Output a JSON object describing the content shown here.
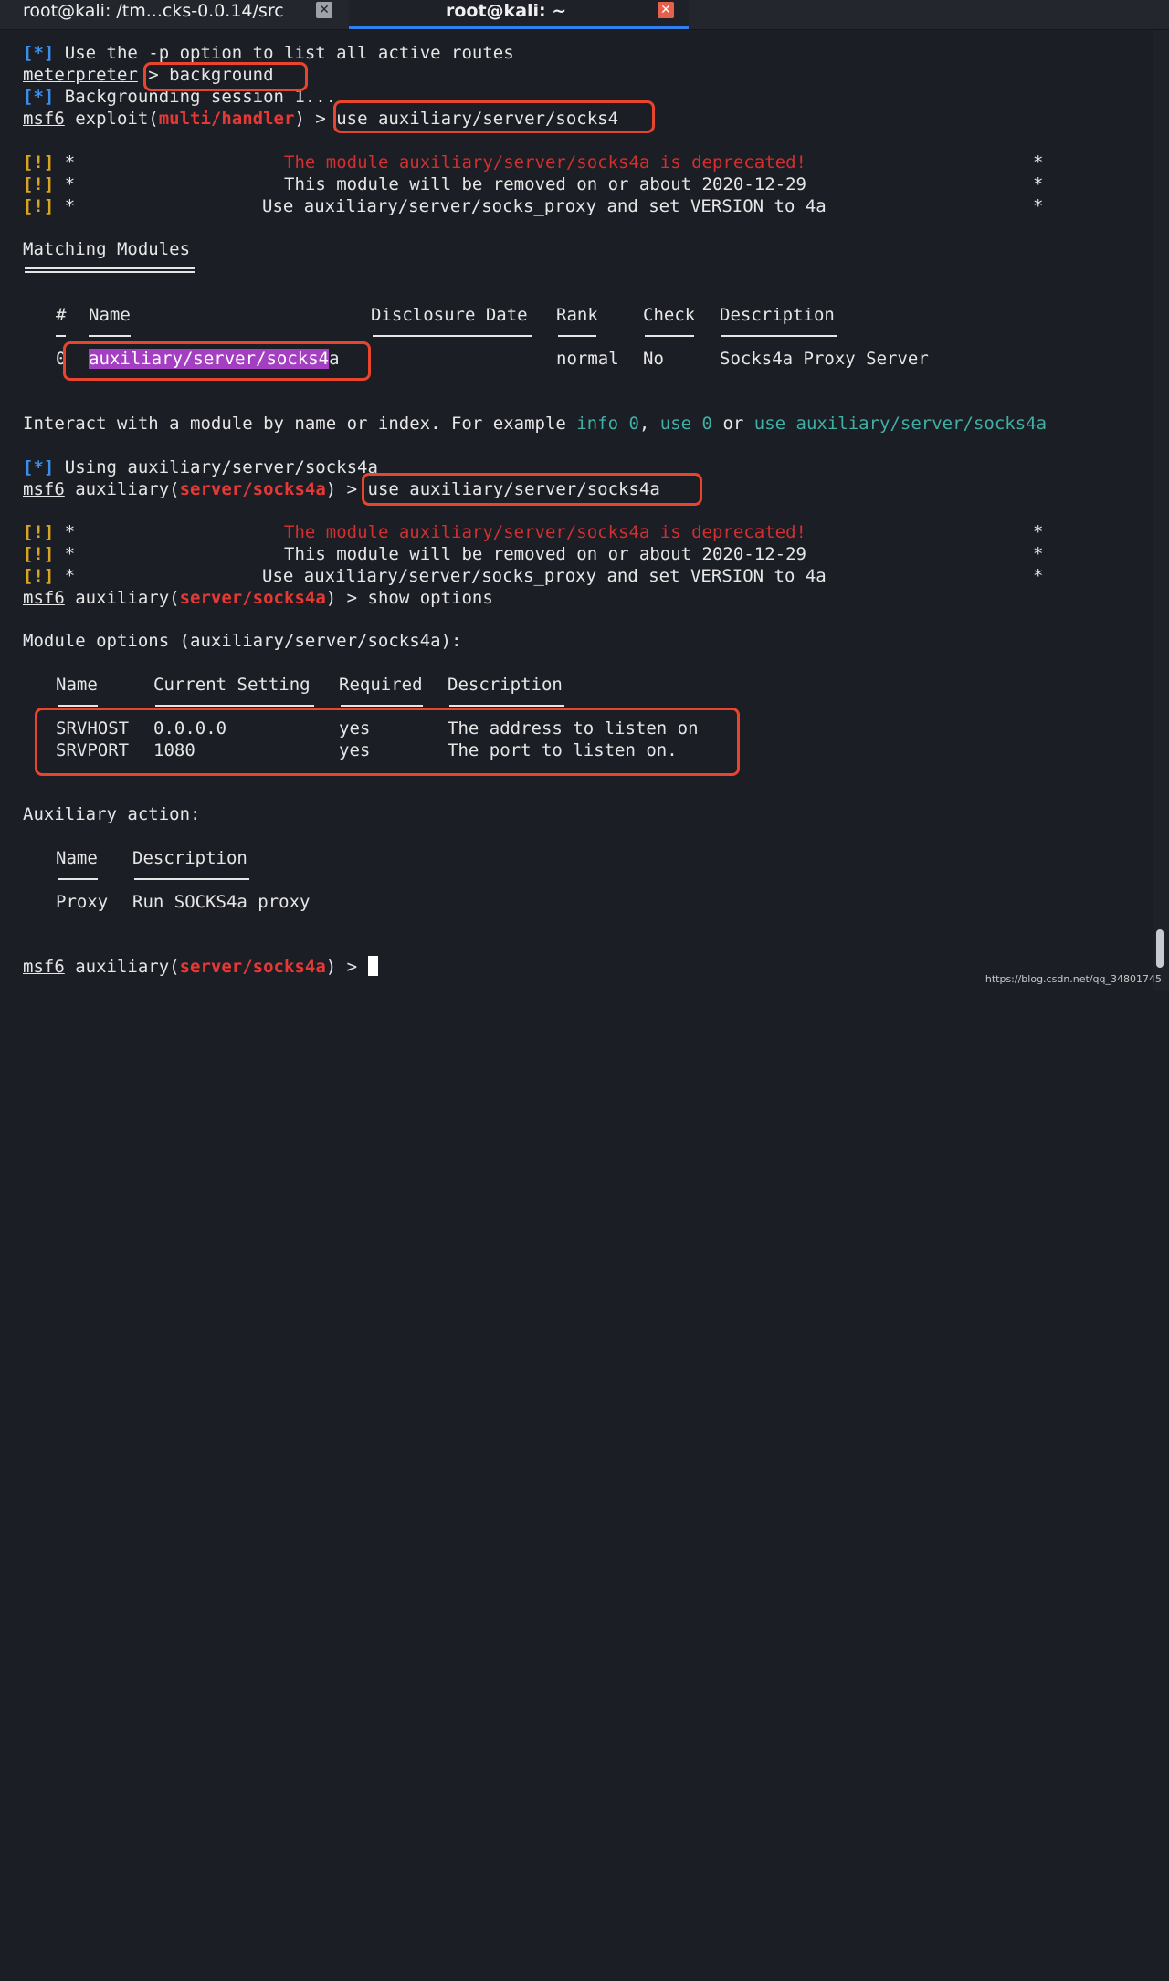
{
  "tabs": [
    {
      "title": "root@kali: /tm...cks-0.0.14/src",
      "close": "✕"
    },
    {
      "title": "root@kali: ~",
      "close": "✕"
    }
  ],
  "lines": {
    "l1_tag": "[*]",
    "l1_text": " Use the -p option to list all active routes",
    "l2_prompt": "meterpreter",
    "l2_cmd": " > background",
    "l3_tag": "[*]",
    "l3_text": " Backgrounding session 1...",
    "l4_msf": "msf6",
    "l4_a": " exploit(",
    "l4_mod": "multi/handler",
    "l4_b": ") > use auxiliary/server/socks4",
    "warn_tag": "[!]",
    "warn_star": " *",
    "w1": "The module auxiliary/server/socks4a is deprecated!",
    "w2": "This module will be removed on or about 2020-12-29",
    "w3": "Use auxiliary/server/socks_proxy and set VERSION to 4a",
    "star": "*",
    "matching": "Matching Modules",
    "col_hash": "#",
    "col_name": "Name",
    "col_date": "Disclosure Date",
    "col_rank": "Rank",
    "col_check": "Check",
    "col_desc": "Description",
    "row_idx": "0",
    "row_name_hl": "auxiliary/server/socks4",
    "row_name_tail": "a",
    "row_rank": "normal",
    "row_check": "No",
    "row_desc": "Socks4a Proxy Server",
    "interact_a": "Interact with a module by name or index. For example ",
    "interact_info": "info 0",
    "interact_b": ", ",
    "interact_use0": "use 0",
    "interact_c": " or ",
    "interact_use": "use auxiliary/server/socks4a",
    "using_tag": "[*]",
    "using_text": " Using auxiliary/server/socks4a",
    "msf": "msf6",
    "aux_a": " auxiliary(",
    "aux_mod": "server/socks4a",
    "p2_b": ") > use auxiliary/server/socks4a",
    "p3_b": ") > show options",
    "modopts": "Module options (auxiliary/server/socks4a):",
    "oc_name": "Name",
    "oc_setting": "Current Setting",
    "oc_req": "Required",
    "oc_desc": "Description",
    "o1_name": "SRVHOST",
    "o1_set": "0.0.0.0",
    "o1_req": "yes",
    "o1_desc": "The address to listen on",
    "o2_name": "SRVPORT",
    "o2_set": "1080",
    "o2_req": "yes",
    "o2_desc": "The port to listen on.",
    "auxaction": "Auxiliary action:",
    "ac_name": "Name",
    "ac_desc": "Description",
    "a1_name": "Proxy",
    "a1_desc": "Run SOCKS4a proxy",
    "final_b": ") > "
  },
  "watermark": "https://blog.csdn.net/qq_34801745",
  "colors": {
    "accent": "#2f80ed",
    "annotation_box": "#e8452c",
    "module_red": "#e53935",
    "tag_blue": "#3b8eea",
    "tag_yellow": "#d9a41f"
  }
}
